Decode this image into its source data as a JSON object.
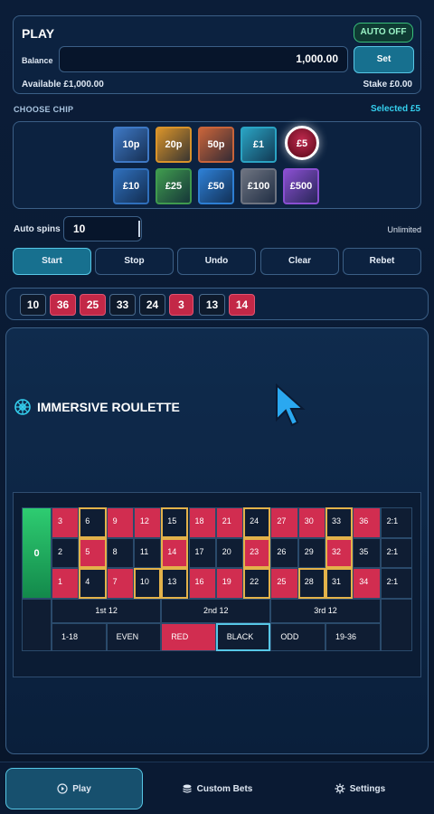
{
  "play": {
    "title": "PLAY",
    "auto_label": "AUTO OFF",
    "balance_label": "Balance",
    "balance_value": "1,000.00",
    "set_label": "Set",
    "available": "Available £1,000.00",
    "stake": "Stake £0.00"
  },
  "chips": {
    "heading": "CHOOSE CHIP",
    "selected": "Selected £5",
    "items": [
      {
        "label": "10p",
        "color": "#3e78c4"
      },
      {
        "label": "20p",
        "color": "#d9932a"
      },
      {
        "label": "50p",
        "color": "#c8643a"
      },
      {
        "label": "£1",
        "color": "#2aa3c3"
      },
      {
        "label": "£5",
        "color": "#b0243f"
      },
      {
        "label": "£10",
        "color": "#2f6fbb"
      },
      {
        "label": "£25",
        "color": "#3f9a4e"
      },
      {
        "label": "£50",
        "color": "#2d7ed3"
      },
      {
        "label": "£100",
        "color": "#6d7380"
      },
      {
        "label": "£500",
        "color": "#8a4fd1"
      }
    ]
  },
  "auto_spins": {
    "label": "Auto spins",
    "value": "10",
    "unlimited": "Unlimited"
  },
  "actions": {
    "start": "Start",
    "stop": "Stop",
    "undo": "Undo",
    "clear": "Clear",
    "rebet": "Rebet"
  },
  "history": [
    {
      "n": "10",
      "c": "black"
    },
    {
      "n": "36",
      "c": "red"
    },
    {
      "n": "25",
      "c": "red"
    },
    {
      "n": "33",
      "c": "black"
    },
    {
      "n": "24",
      "c": "black"
    },
    {
      "n": "3",
      "c": "red"
    },
    {
      "n": "13",
      "c": "black"
    },
    {
      "n": "14",
      "c": "red"
    }
  ],
  "game": {
    "title": "IMMERSIVE ROULETTE",
    "icon": "roulette-wheel-icon"
  },
  "board": {
    "zero": "0",
    "rows": [
      [
        {
          "n": "3",
          "c": "red"
        },
        {
          "n": "6",
          "c": "black",
          "sel": true
        },
        {
          "n": "9",
          "c": "red"
        },
        {
          "n": "12",
          "c": "red"
        },
        {
          "n": "15",
          "c": "black",
          "sel": true
        },
        {
          "n": "18",
          "c": "red"
        },
        {
          "n": "21",
          "c": "red"
        },
        {
          "n": "24",
          "c": "black",
          "sel": true
        },
        {
          "n": "27",
          "c": "red"
        },
        {
          "n": "30",
          "c": "red"
        },
        {
          "n": "33",
          "c": "black",
          "sel": true
        },
        {
          "n": "36",
          "c": "red"
        }
      ],
      [
        {
          "n": "2",
          "c": "black"
        },
        {
          "n": "5",
          "c": "red",
          "sel": true
        },
        {
          "n": "8",
          "c": "black"
        },
        {
          "n": "11",
          "c": "black"
        },
        {
          "n": "14",
          "c": "red",
          "sel": true
        },
        {
          "n": "17",
          "c": "black"
        },
        {
          "n": "20",
          "c": "black"
        },
        {
          "n": "23",
          "c": "red",
          "sel": true
        },
        {
          "n": "26",
          "c": "black"
        },
        {
          "n": "29",
          "c": "black"
        },
        {
          "n": "32",
          "c": "red",
          "sel": true
        },
        {
          "n": "35",
          "c": "black"
        }
      ],
      [
        {
          "n": "1",
          "c": "red"
        },
        {
          "n": "4",
          "c": "black",
          "sel": true
        },
        {
          "n": "7",
          "c": "red"
        },
        {
          "n": "10",
          "c": "black",
          "sel": true
        },
        {
          "n": "13",
          "c": "black",
          "sel": true
        },
        {
          "n": "16",
          "c": "red"
        },
        {
          "n": "19",
          "c": "red"
        },
        {
          "n": "22",
          "c": "black",
          "sel": true
        },
        {
          "n": "25",
          "c": "red"
        },
        {
          "n": "28",
          "c": "black",
          "sel": true
        },
        {
          "n": "31",
          "c": "black",
          "sel": true
        },
        {
          "n": "34",
          "c": "red"
        }
      ]
    ],
    "column_label": "2:1",
    "dozens": [
      "1st 12",
      "2nd 12",
      "3rd 12"
    ],
    "outside": [
      {
        "label": "1-18",
        "style": "black"
      },
      {
        "label": "EVEN",
        "style": "black"
      },
      {
        "label": "RED",
        "style": "red"
      },
      {
        "label": "BLACK",
        "style": "black",
        "active": true
      },
      {
        "label": "ODD",
        "style": "black"
      },
      {
        "label": "19-36",
        "style": "black"
      }
    ]
  },
  "nav": {
    "play": "Play",
    "custom_bets": "Custom Bets",
    "settings": "Settings"
  }
}
